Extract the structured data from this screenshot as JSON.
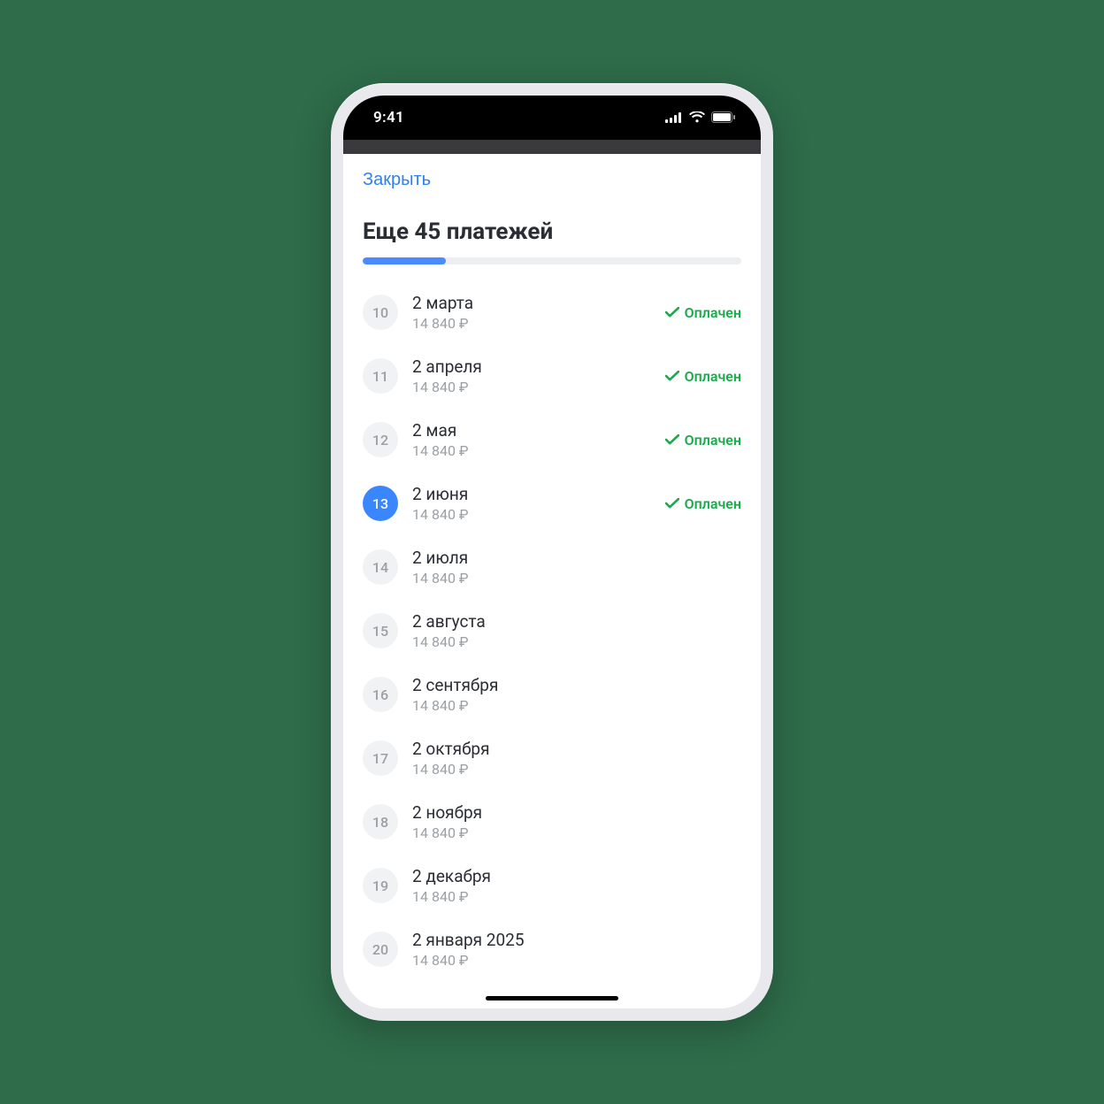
{
  "statusBar": {
    "time": "9:41"
  },
  "nav": {
    "close": "Закрыть"
  },
  "title": "Еще 45 платежей",
  "progress": {
    "percent": 22
  },
  "statusLabel": "Оплачен",
  "payments": [
    {
      "num": "10",
      "date": "2 марта",
      "amount": "14 840 ₽",
      "paid": true,
      "active": false
    },
    {
      "num": "11",
      "date": "2 апреля",
      "amount": "14 840 ₽",
      "paid": true,
      "active": false
    },
    {
      "num": "12",
      "date": "2 мая",
      "amount": "14 840 ₽",
      "paid": true,
      "active": false
    },
    {
      "num": "13",
      "date": "2 июня",
      "amount": "14 840 ₽",
      "paid": true,
      "active": true
    },
    {
      "num": "14",
      "date": "2 июля",
      "amount": "14 840 ₽",
      "paid": false,
      "active": false
    },
    {
      "num": "15",
      "date": "2 августа",
      "amount": "14 840 ₽",
      "paid": false,
      "active": false
    },
    {
      "num": "16",
      "date": "2 сентября",
      "amount": "14 840 ₽",
      "paid": false,
      "active": false
    },
    {
      "num": "17",
      "date": "2 октября",
      "amount": "14 840 ₽",
      "paid": false,
      "active": false
    },
    {
      "num": "18",
      "date": "2 ноября",
      "amount": "14 840 ₽",
      "paid": false,
      "active": false
    },
    {
      "num": "19",
      "date": "2 декабря",
      "amount": "14 840 ₽",
      "paid": false,
      "active": false
    },
    {
      "num": "20",
      "date": "2 января 2025",
      "amount": "14 840 ₽",
      "paid": false,
      "active": false
    }
  ]
}
